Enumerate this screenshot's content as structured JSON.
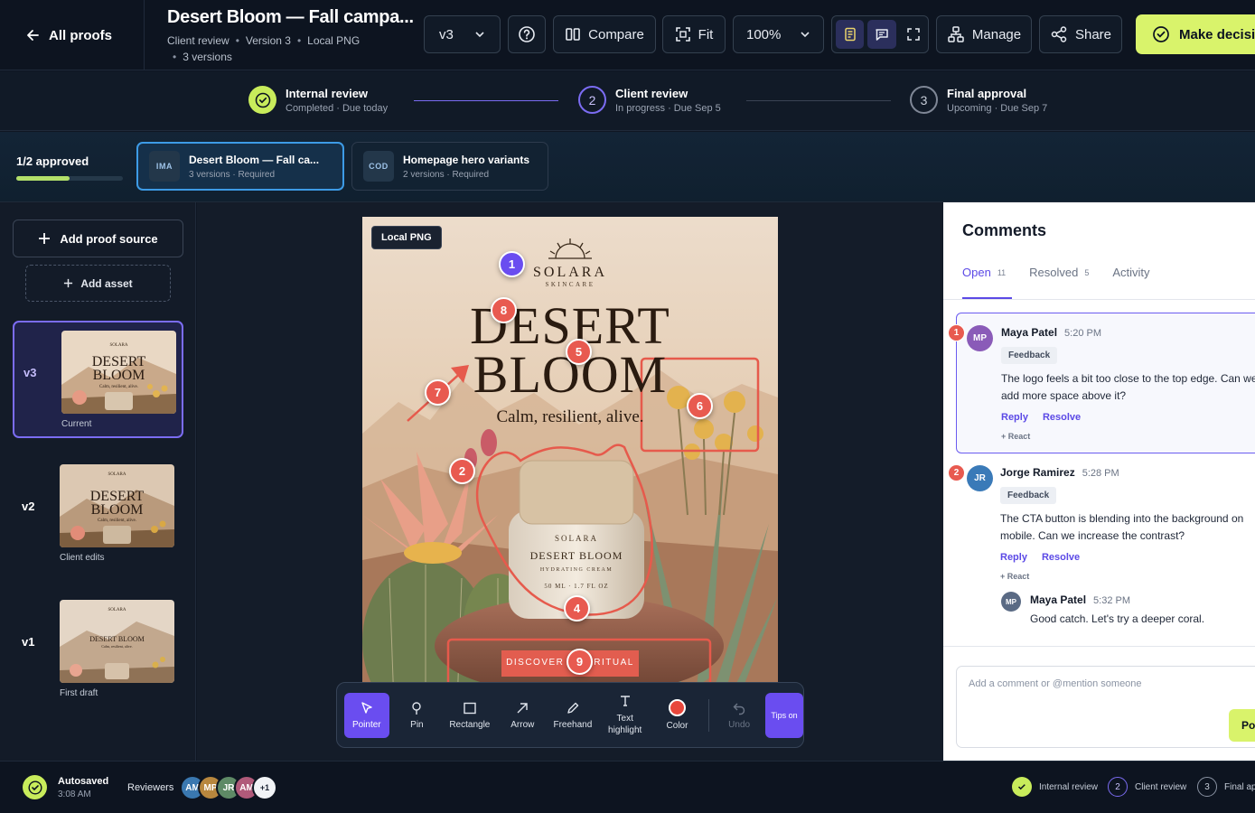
{
  "header": {
    "back_label": "All proofs",
    "title": "Desert Bloom — Fall campa...",
    "meta": [
      "Client review",
      "Version 3",
      "Local PNG",
      "3 versions"
    ],
    "version_select": "v3",
    "compare_label": "Compare",
    "fit_label": "Fit",
    "zoom_select": "100%",
    "manage_label": "Manage",
    "share_label": "Share",
    "decision_label": "Make decision"
  },
  "stages": [
    {
      "num": "",
      "title": "Internal review",
      "sub": "Completed · Due today"
    },
    {
      "num": "2",
      "title": "Client review",
      "sub": "In progress · Due Sep 5"
    },
    {
      "num": "3",
      "title": "Final approval",
      "sub": "Upcoming · Due Sep 7"
    }
  ],
  "assets": {
    "approved_label": "1/2 approved",
    "approved_fraction": 0.5,
    "items": [
      {
        "code": "IMA",
        "name": "Desert Bloom — Fall ca...",
        "sub": "3 versions · Required"
      },
      {
        "code": "COD",
        "name": "Homepage hero variants",
        "sub": "2 versions · Required"
      }
    ]
  },
  "sidebar": {
    "add_source_label": "Add proof source",
    "add_asset_label": "Add asset",
    "versions": [
      {
        "label": "v3",
        "caption": "Current"
      },
      {
        "label": "v2",
        "caption": "Client edits"
      },
      {
        "label": "v1",
        "caption": "First draft"
      }
    ]
  },
  "poster": {
    "source_badge": "Local PNG",
    "brand": "SOLARA",
    "brand_sub": "SKINCARE",
    "headline_1": "DESERT",
    "headline_2": "BLOOM",
    "tagline": "Calm, resilient, alive.",
    "jar_brand": "SOLARA",
    "jar_name": "DESERT BLOOM",
    "jar_sub": "HYDRATING CREAM",
    "jar_size": "50 ML · 1.7 FL OZ",
    "cta": "DISCOVER THE RITUAL",
    "markers": [
      "1",
      "2",
      "4",
      "5",
      "6",
      "7",
      "8",
      "9"
    ]
  },
  "toolbar": {
    "tools": [
      "Pointer",
      "Pin",
      "Rectangle",
      "Arrow",
      "Freehand",
      "Text highlight",
      "Color",
      "Undo"
    ],
    "tips_label": "Tips on",
    "color_value": "#e8473c"
  },
  "comments": {
    "heading": "Comments",
    "tabs": [
      {
        "label": "Open",
        "count": "11"
      },
      {
        "label": "Resolved",
        "count": "5"
      },
      {
        "label": "Activity",
        "count": ""
      }
    ],
    "items": [
      {
        "num": "1",
        "initials": "MP",
        "author": "Maya Patel",
        "time": "5:20 PM",
        "tag": "Feedback",
        "line1": "The logo feels a bit too close to the top edge. Can we",
        "line2": "add more space above it?",
        "reply": "Reply",
        "resolve": "Resolve",
        "react": "+ React"
      },
      {
        "num": "2",
        "initials": "JR",
        "author": "Jorge Ramirez",
        "time": "5:28 PM",
        "tag": "Feedback",
        "line1": "The CTA button is blending into the background on",
        "line2": "mobile. Can we increase the contrast?",
        "reply": "Reply",
        "resolve": "Resolve",
        "react": "+ React"
      }
    ],
    "reply_item": {
      "initials": "MP",
      "author": "Maya Patel",
      "time": "5:32 PM",
      "text": "Good catch. Let's try a deeper coral."
    },
    "input_placeholder": "Add a comment or @mention someone",
    "post_label": "Post"
  },
  "footer": {
    "autosave_label": "Autosaved",
    "autosave_time": "3:08 AM",
    "reviewers_label": "Reviewers",
    "avatars": [
      "AM",
      "MP",
      "JR",
      "AM",
      "+1"
    ],
    "stages": [
      {
        "num": "",
        "label": "Internal review"
      },
      {
        "num": "2",
        "label": "Client review"
      },
      {
        "num": "3",
        "label": "Final approval"
      }
    ]
  },
  "colors": {
    "accent": "#6a4df0",
    "lime": "#d9f36b",
    "marker_red": "#e85a50"
  }
}
